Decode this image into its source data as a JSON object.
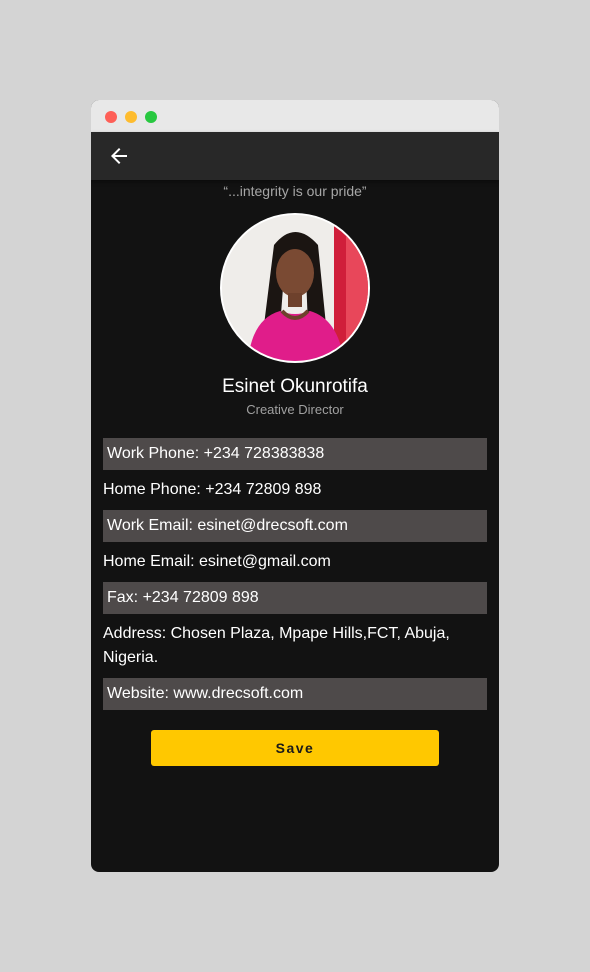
{
  "window": {
    "controls": [
      "close",
      "minimize",
      "maximize"
    ]
  },
  "appbar": {
    "back_icon": "arrow-left-icon"
  },
  "profile": {
    "quote": "“...integrity is our pride”",
    "name": "Esinet Okunrotifa",
    "role": "Creative Director"
  },
  "fields": [
    {
      "text": "Work Phone: +234 728383838",
      "shaded": true
    },
    {
      "text": "Home Phone: +234 72809 898",
      "shaded": false
    },
    {
      "text": "Work Email: esinet@drecsoft.com",
      "shaded": true
    },
    {
      "text": "Home Email: esinet@gmail.com",
      "shaded": false
    },
    {
      "text": "Fax: +234 72809 898",
      "shaded": true
    },
    {
      "text": "Address: Chosen Plaza, Mpape Hills,FCT, Abuja, Nigeria.",
      "shaded": false
    },
    {
      "text": "Website: www.drecsoft.com",
      "shaded": true
    }
  ],
  "actions": {
    "save_label": "Save"
  },
  "colors": {
    "background": "#121212",
    "appbar": "#282828",
    "field_shade": "#4e4a4a",
    "accent": "#ffc800"
  }
}
